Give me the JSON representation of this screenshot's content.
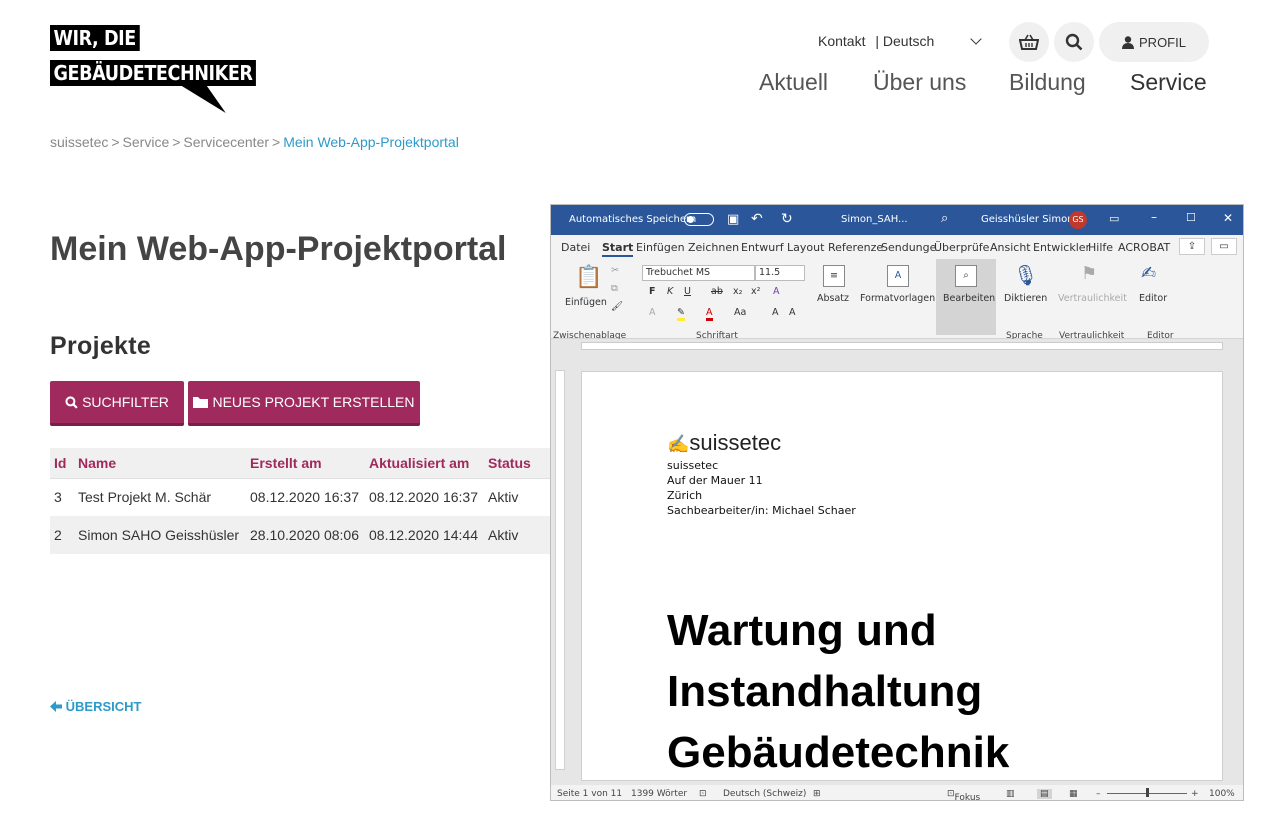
{
  "logo": {
    "line1": "WIR, DIE",
    "line2": "GEBÄUDETECHNIKER"
  },
  "header": {
    "contact": "Kontakt",
    "language": "| Deutsch",
    "profile": "PROFIL",
    "nav": [
      "Aktuell",
      "Über uns",
      "Bildung",
      "Service"
    ]
  },
  "breadcrumb": {
    "items": [
      "suissetec",
      "Service",
      "Servicecenter"
    ],
    "current": "Mein Web-App-Projektportal",
    "separator": ">"
  },
  "page": {
    "title": "Mein Web-App-Projektportal",
    "section_title": "Projekte",
    "search_button": "SUCHFILTER",
    "new_button": "NEUES PROJEKT ERSTELLEN",
    "back_link": "ÜBERSICHT"
  },
  "table": {
    "headers": [
      "Id",
      "Name",
      "Erstellt am",
      "Aktualisiert am",
      "Status"
    ],
    "rows": [
      [
        "3",
        "Test Projekt M. Schär",
        "08.12.2020 16:37",
        "08.12.2020 16:37",
        "Aktiv"
      ],
      [
        "2",
        "Simon SAHO Geisshüsler",
        "28.10.2020 08:06",
        "08.12.2020 14:44",
        "Aktiv"
      ]
    ]
  },
  "word": {
    "autosave": "Automatisches Speichern",
    "filename": "Simon_SAH...",
    "user": "Geisshüsler Simon",
    "user_initials": "GS",
    "menu": [
      "Datei",
      "Start",
      "Einfügen",
      "Zeichnen",
      "Entwurf",
      "Layout",
      "Referenze",
      "Sendunge",
      "Überprüfe",
      "Ansicht",
      "Entwickler",
      "Hilfe",
      "ACROBAT"
    ],
    "font_name": "Trebuchet MS",
    "font_size": "11.5",
    "ribbon_buttons": [
      "Einfügen",
      "Absatz",
      "Formatvorlagen",
      "Bearbeiten",
      "Diktieren",
      "Vertraulichkeit",
      "Editor"
    ],
    "ribbon_groups": [
      "Zwischenablage",
      "Schriftart",
      "Sprache",
      "Vertraulichkeit",
      "Editor"
    ],
    "doc": {
      "brand": "suissetec",
      "address": [
        "suissetec",
        "Auf der Mauer 11",
        "Zürich",
        "Sachbearbeiter/in: Michael Schaer"
      ],
      "title_lines": [
        "Wartung und",
        "Instandhaltung",
        "Gebäudetechnik"
      ]
    },
    "status": {
      "page": "Seite 1 von 11",
      "words": "1399 Wörter",
      "language": "Deutsch (Schweiz)",
      "focus": "Fokus",
      "zoom": "100%"
    }
  },
  "colors": {
    "accent": "#a02a5d",
    "link": "#2e9ac9",
    "word_blue": "#2b579a"
  }
}
